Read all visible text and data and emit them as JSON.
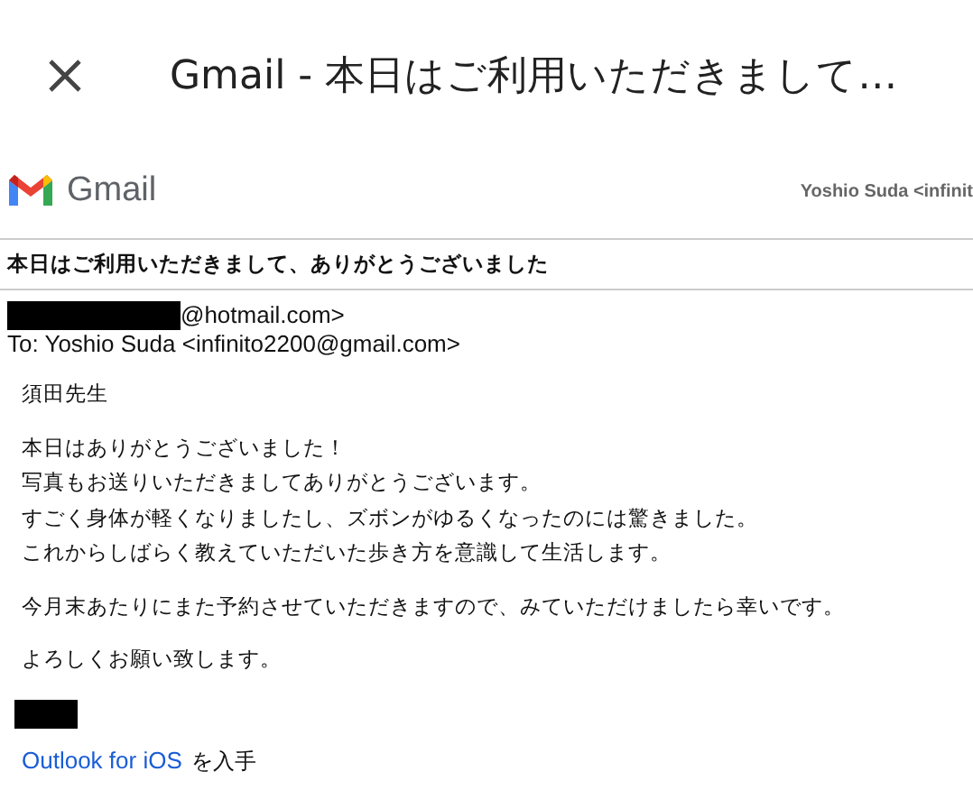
{
  "top_bar": {
    "title": "Gmail - 本日はご利用いただきまして…"
  },
  "print_header": {
    "brand": "Gmail",
    "sender": "Yoshio Suda <infinit"
  },
  "email": {
    "subject": "本日はご利用いただきまして、ありがとうございました",
    "from": "@hotmail.com>",
    "to": "To: Yoshio Suda <infinito2200@gmail.com>",
    "paragraphs": [
      [
        "須田先生"
      ],
      [
        "本日はありがとうございました！",
        "写真もお送りいただきましてありがとうございます。",
        "すごく身体が軽くなりましたし、ズボンがゆるくなったのには驚きました。",
        "これからしばらく教えていただいた歩き方を意識して生活します。"
      ],
      [
        "今月末あたりにまた予約させていただきますので、みていただけましたら幸いです。"
      ],
      [
        "よろしくお願い致します。"
      ]
    ],
    "footer": {
      "link": "Outlook for iOS",
      "suffix": "を入手"
    }
  }
}
